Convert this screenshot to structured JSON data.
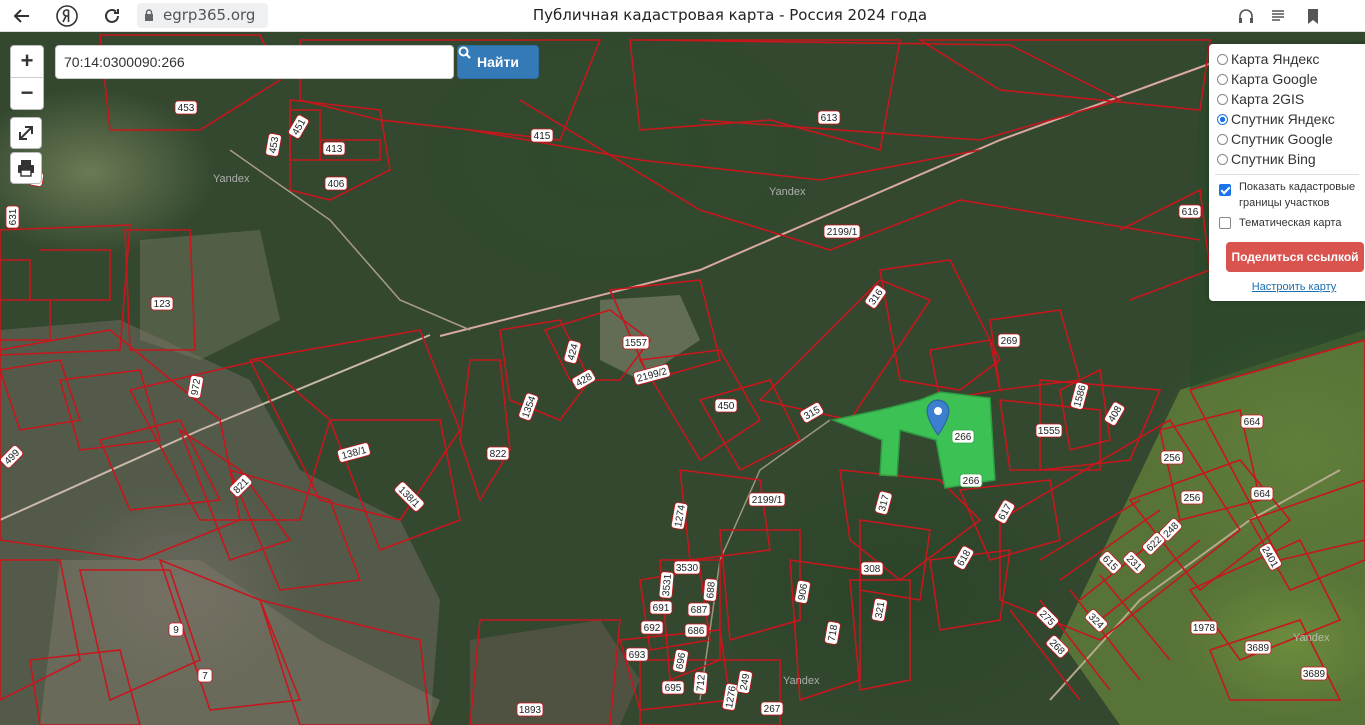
{
  "browser": {
    "url": "egrp365.org",
    "page_title": "Публичная кадастровая карта - Россия 2024 года",
    "icons": [
      "back-arrow-icon",
      "yandex-logo-icon",
      "reload-icon",
      "lock-icon",
      "headphones-icon",
      "reader-icon",
      "bookmark-icon"
    ]
  },
  "map": {
    "controls": {
      "zoom_in": "+",
      "zoom_out": "−"
    },
    "search": {
      "value": "70:14:0300090:266",
      "button": "Найти"
    },
    "layers": [
      {
        "label": "Карта Яндекс",
        "selected": false
      },
      {
        "label": "Карта Google",
        "selected": false
      },
      {
        "label": "Карта 2GIS",
        "selected": false
      },
      {
        "label": "Спутник Яндекс",
        "selected": true
      },
      {
        "label": "Спутник Google",
        "selected": false
      },
      {
        "label": "Спутник Bing",
        "selected": false
      }
    ],
    "options": {
      "show_borders_line1": "Показать кадастровые",
      "show_borders_line2": "границы участков",
      "show_borders_checked": true,
      "thematic": "Тематическая карта",
      "thematic_checked": false
    },
    "share_button": "Поделиться ссылкой",
    "settings_link": "Настроить карту",
    "watermark": "Yandex",
    "highlight_color": "#3ecf5a",
    "border_color": "#c8161d",
    "parcel_labels": [
      "453",
      "451",
      "453",
      "413",
      "406",
      "415",
      "613",
      "616",
      "2199/1",
      "631",
      "123",
      "316",
      "269",
      "1557",
      "424",
      "428",
      "2199/2",
      "972",
      "1354",
      "450",
      "315",
      "266",
      "266",
      "1586",
      "408",
      "1555",
      "664",
      "664",
      "499",
      "138/1",
      "822",
      "821",
      "138/1",
      "2199/1",
      "1274",
      "317",
      "617",
      "256",
      "256",
      "248",
      "622",
      "615",
      "231",
      "2401",
      "3530",
      "3531",
      "688",
      "691",
      "687",
      "692",
      "686",
      "906",
      "308",
      "618",
      "718",
      "321",
      "275",
      "324",
      "1978",
      "268",
      "3689",
      "3689",
      "693",
      "696",
      "712",
      "695",
      "1276",
      "249",
      "267",
      "9",
      "7",
      "1893",
      "6"
    ]
  }
}
